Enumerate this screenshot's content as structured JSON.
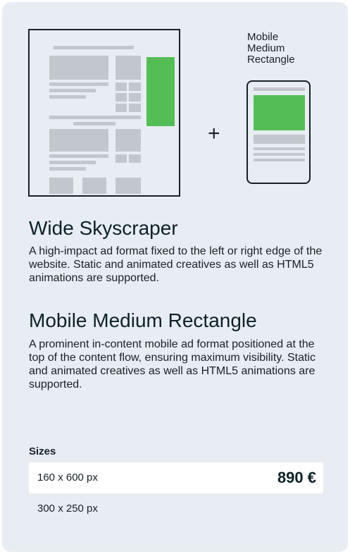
{
  "illustration": {
    "plus_sign": "+",
    "mobile_label": "Mobile\nMedium\nRectangle",
    "accent_color": "#55bd56",
    "placeholder_color": "#c1c7cc"
  },
  "formats": [
    {
      "title": "Wide Skyscraper",
      "description": "A high-impact ad format fixed to the left or right edge of the website. Static and animated creatives as well as HTML5 animations are supported."
    },
    {
      "title": "Mobile Medium Rectangle",
      "description": "A prominent in-content mobile ad format positioned at the top of the content flow, ensuring maximum visibility. Static and animated creatives as well as HTML5 animations are supported."
    }
  ],
  "sizes": {
    "label": "Sizes",
    "options": [
      {
        "size": "160 x 600 px",
        "price": "890 €",
        "selected": true
      },
      {
        "size": "300 x 250 px",
        "price": "",
        "selected": false
      }
    ]
  }
}
